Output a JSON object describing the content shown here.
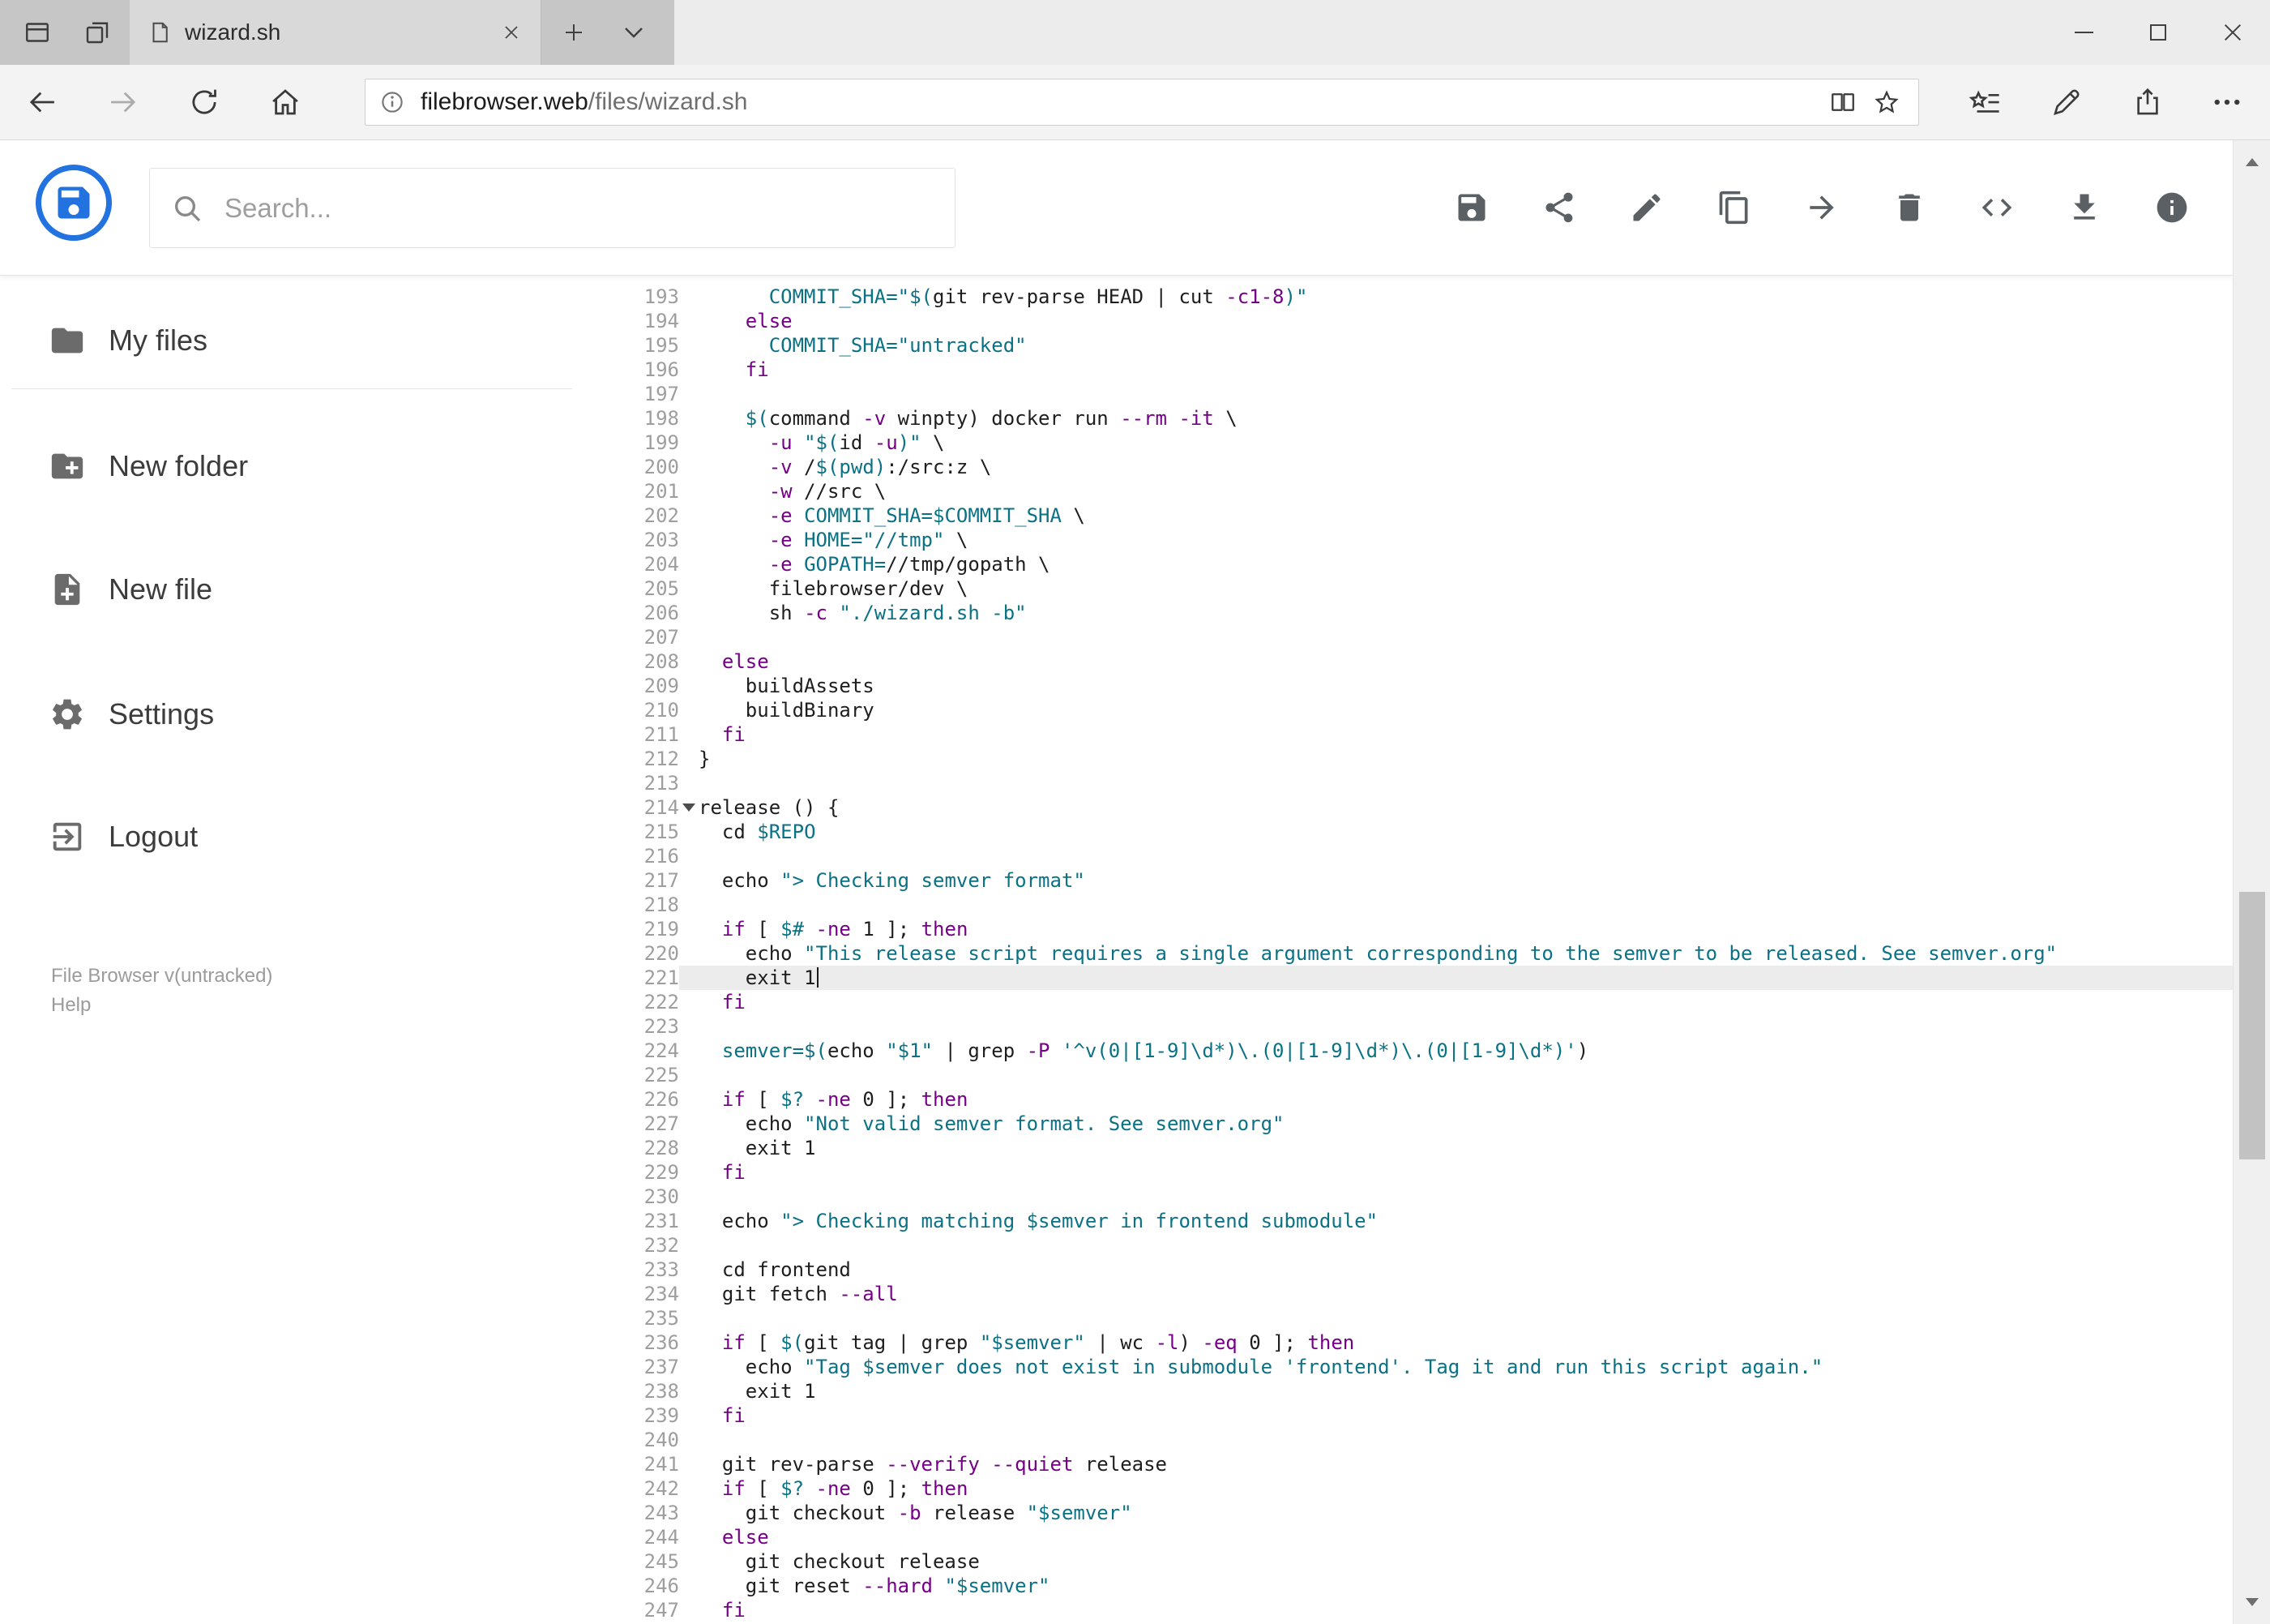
{
  "window": {
    "tab_title": "wizard.sh"
  },
  "browser": {
    "url_host": "filebrowser.web",
    "url_path": "/files/wizard.sh"
  },
  "app": {
    "search_placeholder": "Search...",
    "toolbar_icons": [
      "save",
      "share",
      "edit",
      "copy",
      "move",
      "delete",
      "code",
      "download",
      "info"
    ],
    "sidebar": {
      "items": [
        {
          "icon": "folder",
          "label": "My files"
        },
        {
          "icon": "new-folder",
          "label": "New folder"
        },
        {
          "icon": "new-file",
          "label": "New file"
        },
        {
          "icon": "settings",
          "label": "Settings"
        },
        {
          "icon": "logout",
          "label": "Logout"
        }
      ],
      "footer_version": "File Browser v(untracked)",
      "footer_help": "Help"
    }
  },
  "editor": {
    "active_line": 221,
    "cursor_line": 221,
    "fold_line": 214,
    "colors": {
      "plain": "#1e1e1e",
      "keyword": "#770088",
      "string": "#0b7285",
      "variable": "#0b7285",
      "flag": "#770088",
      "active_line_bg": "#ececec",
      "gutter": "#9e9e9e"
    },
    "lines": [
      {
        "n": 193,
        "i": 6,
        "t": [
          [
            "v",
            "COMMIT_SHA="
          ],
          [
            "s",
            "\"$("
          ],
          [
            "p",
            "git rev-parse HEAD | cut "
          ],
          [
            "f",
            "-c1-8"
          ],
          [
            "s",
            ")\""
          ]
        ]
      },
      {
        "n": 194,
        "i": 4,
        "t": [
          [
            "k",
            "else"
          ]
        ]
      },
      {
        "n": 195,
        "i": 6,
        "t": [
          [
            "v",
            "COMMIT_SHA="
          ],
          [
            "s",
            "\"untracked\""
          ]
        ]
      },
      {
        "n": 196,
        "i": 4,
        "t": [
          [
            "k",
            "fi"
          ]
        ]
      },
      {
        "n": 197,
        "i": 0,
        "t": []
      },
      {
        "n": 198,
        "i": 4,
        "t": [
          [
            "v",
            "$("
          ],
          [
            "p",
            "command "
          ],
          [
            "f",
            "-v"
          ],
          [
            "p",
            " winpty) docker run "
          ],
          [
            "f",
            "--rm"
          ],
          [
            "p",
            " "
          ],
          [
            "f",
            "-it"
          ],
          [
            "p",
            " \\"
          ]
        ]
      },
      {
        "n": 199,
        "i": 6,
        "t": [
          [
            "f",
            "-u"
          ],
          [
            "p",
            " "
          ],
          [
            "s",
            "\"$("
          ],
          [
            "p",
            "id "
          ],
          [
            "f",
            "-u"
          ],
          [
            "s",
            ")\""
          ],
          [
            "p",
            " \\"
          ]
        ]
      },
      {
        "n": 200,
        "i": 6,
        "t": [
          [
            "f",
            "-v"
          ],
          [
            "p",
            " /"
          ],
          [
            "v",
            "$(pwd)"
          ],
          [
            "p",
            ":/src:z \\"
          ]
        ]
      },
      {
        "n": 201,
        "i": 6,
        "t": [
          [
            "f",
            "-w"
          ],
          [
            "p",
            " //src \\"
          ]
        ]
      },
      {
        "n": 202,
        "i": 6,
        "t": [
          [
            "f",
            "-e"
          ],
          [
            "p",
            " "
          ],
          [
            "v",
            "COMMIT_SHA=$COMMIT_SHA"
          ],
          [
            "p",
            " \\"
          ]
        ]
      },
      {
        "n": 203,
        "i": 6,
        "t": [
          [
            "f",
            "-e"
          ],
          [
            "p",
            " "
          ],
          [
            "v",
            "HOME="
          ],
          [
            "s",
            "\"//tmp\""
          ],
          [
            "p",
            " \\"
          ]
        ]
      },
      {
        "n": 204,
        "i": 6,
        "t": [
          [
            "f",
            "-e"
          ],
          [
            "p",
            " "
          ],
          [
            "v",
            "GOPATH="
          ],
          [
            "p",
            "//tmp/gopath \\"
          ]
        ]
      },
      {
        "n": 205,
        "i": 6,
        "t": [
          [
            "p",
            "filebrowser/dev \\"
          ]
        ]
      },
      {
        "n": 206,
        "i": 6,
        "t": [
          [
            "p",
            "sh "
          ],
          [
            "f",
            "-c"
          ],
          [
            "p",
            " "
          ],
          [
            "s",
            "\"./wizard.sh -b\""
          ]
        ]
      },
      {
        "n": 207,
        "i": 0,
        "t": []
      },
      {
        "n": 208,
        "i": 2,
        "t": [
          [
            "k",
            "else"
          ]
        ]
      },
      {
        "n": 209,
        "i": 4,
        "t": [
          [
            "p",
            "buildAssets"
          ]
        ]
      },
      {
        "n": 210,
        "i": 4,
        "t": [
          [
            "p",
            "buildBinary"
          ]
        ]
      },
      {
        "n": 211,
        "i": 2,
        "t": [
          [
            "k",
            "fi"
          ]
        ]
      },
      {
        "n": 212,
        "i": 0,
        "t": [
          [
            "p",
            "}"
          ]
        ]
      },
      {
        "n": 213,
        "i": 0,
        "t": []
      },
      {
        "n": 214,
        "i": 0,
        "t": [
          [
            "p",
            "release () {"
          ]
        ]
      },
      {
        "n": 215,
        "i": 2,
        "t": [
          [
            "p",
            "cd "
          ],
          [
            "v",
            "$REPO"
          ]
        ]
      },
      {
        "n": 216,
        "i": 0,
        "t": []
      },
      {
        "n": 217,
        "i": 2,
        "t": [
          [
            "p",
            "echo "
          ],
          [
            "s",
            "\"> Checking semver format\""
          ]
        ]
      },
      {
        "n": 218,
        "i": 0,
        "t": []
      },
      {
        "n": 219,
        "i": 2,
        "t": [
          [
            "k",
            "if"
          ],
          [
            "p",
            " [ "
          ],
          [
            "v",
            "$#"
          ],
          [
            "p",
            " "
          ],
          [
            "f",
            "-ne"
          ],
          [
            "p",
            " 1 ]; "
          ],
          [
            "k",
            "then"
          ]
        ]
      },
      {
        "n": 220,
        "i": 4,
        "t": [
          [
            "p",
            "echo "
          ],
          [
            "s",
            "\"This release script requires a single argument corresponding to the semver to be released. See semver.org\""
          ]
        ]
      },
      {
        "n": 221,
        "i": 4,
        "t": [
          [
            "p",
            "exit 1"
          ]
        ]
      },
      {
        "n": 222,
        "i": 2,
        "t": [
          [
            "k",
            "fi"
          ]
        ]
      },
      {
        "n": 223,
        "i": 0,
        "t": []
      },
      {
        "n": 224,
        "i": 2,
        "t": [
          [
            "v",
            "semver=$("
          ],
          [
            "p",
            "echo "
          ],
          [
            "s",
            "\"$1\""
          ],
          [
            "p",
            " | grep "
          ],
          [
            "f",
            "-P"
          ],
          [
            "p",
            " "
          ],
          [
            "s",
            "'^v(0|[1-9]\\d*)\\.(0|[1-9]\\d*)\\.(0|[1-9]\\d*)'"
          ],
          [
            "p",
            ")"
          ]
        ]
      },
      {
        "n": 225,
        "i": 0,
        "t": []
      },
      {
        "n": 226,
        "i": 2,
        "t": [
          [
            "k",
            "if"
          ],
          [
            "p",
            " [ "
          ],
          [
            "v",
            "$?"
          ],
          [
            "p",
            " "
          ],
          [
            "f",
            "-ne"
          ],
          [
            "p",
            " 0 ]; "
          ],
          [
            "k",
            "then"
          ]
        ]
      },
      {
        "n": 227,
        "i": 4,
        "t": [
          [
            "p",
            "echo "
          ],
          [
            "s",
            "\"Not valid semver format. See semver.org\""
          ]
        ]
      },
      {
        "n": 228,
        "i": 4,
        "t": [
          [
            "p",
            "exit 1"
          ]
        ]
      },
      {
        "n": 229,
        "i": 2,
        "t": [
          [
            "k",
            "fi"
          ]
        ]
      },
      {
        "n": 230,
        "i": 0,
        "t": []
      },
      {
        "n": 231,
        "i": 2,
        "t": [
          [
            "p",
            "echo "
          ],
          [
            "s",
            "\"> Checking matching "
          ],
          [
            "v",
            "$semver"
          ],
          [
            "s",
            " in frontend submodule\""
          ]
        ]
      },
      {
        "n": 232,
        "i": 0,
        "t": []
      },
      {
        "n": 233,
        "i": 2,
        "t": [
          [
            "p",
            "cd frontend"
          ]
        ]
      },
      {
        "n": 234,
        "i": 2,
        "t": [
          [
            "p",
            "git fetch "
          ],
          [
            "f",
            "--all"
          ]
        ]
      },
      {
        "n": 235,
        "i": 0,
        "t": []
      },
      {
        "n": 236,
        "i": 2,
        "t": [
          [
            "k",
            "if"
          ],
          [
            "p",
            " [ "
          ],
          [
            "v",
            "$("
          ],
          [
            "p",
            "git tag | grep "
          ],
          [
            "s",
            "\"$semver\""
          ],
          [
            "p",
            " | wc "
          ],
          [
            "f",
            "-l"
          ],
          [
            "p",
            ") "
          ],
          [
            "f",
            "-eq"
          ],
          [
            "p",
            " 0 ]; "
          ],
          [
            "k",
            "then"
          ]
        ]
      },
      {
        "n": 237,
        "i": 4,
        "t": [
          [
            "p",
            "echo "
          ],
          [
            "s",
            "\"Tag "
          ],
          [
            "v",
            "$semver"
          ],
          [
            "s",
            " does not exist in submodule 'frontend'. Tag it and run this script again.\""
          ]
        ]
      },
      {
        "n": 238,
        "i": 4,
        "t": [
          [
            "p",
            "exit 1"
          ]
        ]
      },
      {
        "n": 239,
        "i": 2,
        "t": [
          [
            "k",
            "fi"
          ]
        ]
      },
      {
        "n": 240,
        "i": 0,
        "t": []
      },
      {
        "n": 241,
        "i": 2,
        "t": [
          [
            "p",
            "git rev-parse "
          ],
          [
            "f",
            "--verify"
          ],
          [
            "p",
            " "
          ],
          [
            "f",
            "--quiet"
          ],
          [
            "p",
            " release"
          ]
        ]
      },
      {
        "n": 242,
        "i": 2,
        "t": [
          [
            "k",
            "if"
          ],
          [
            "p",
            " [ "
          ],
          [
            "v",
            "$?"
          ],
          [
            "p",
            " "
          ],
          [
            "f",
            "-ne"
          ],
          [
            "p",
            " 0 ]; "
          ],
          [
            "k",
            "then"
          ]
        ]
      },
      {
        "n": 243,
        "i": 4,
        "t": [
          [
            "p",
            "git checkout "
          ],
          [
            "f",
            "-b"
          ],
          [
            "p",
            " release "
          ],
          [
            "s",
            "\"$semver\""
          ]
        ]
      },
      {
        "n": 244,
        "i": 2,
        "t": [
          [
            "k",
            "else"
          ]
        ]
      },
      {
        "n": 245,
        "i": 4,
        "t": [
          [
            "p",
            "git checkout release"
          ]
        ]
      },
      {
        "n": 246,
        "i": 4,
        "t": [
          [
            "p",
            "git reset "
          ],
          [
            "f",
            "--hard"
          ],
          [
            "p",
            " "
          ],
          [
            "s",
            "\"$semver\""
          ]
        ]
      },
      {
        "n": 247,
        "i": 2,
        "t": [
          [
            "k",
            "fi"
          ]
        ]
      }
    ]
  }
}
